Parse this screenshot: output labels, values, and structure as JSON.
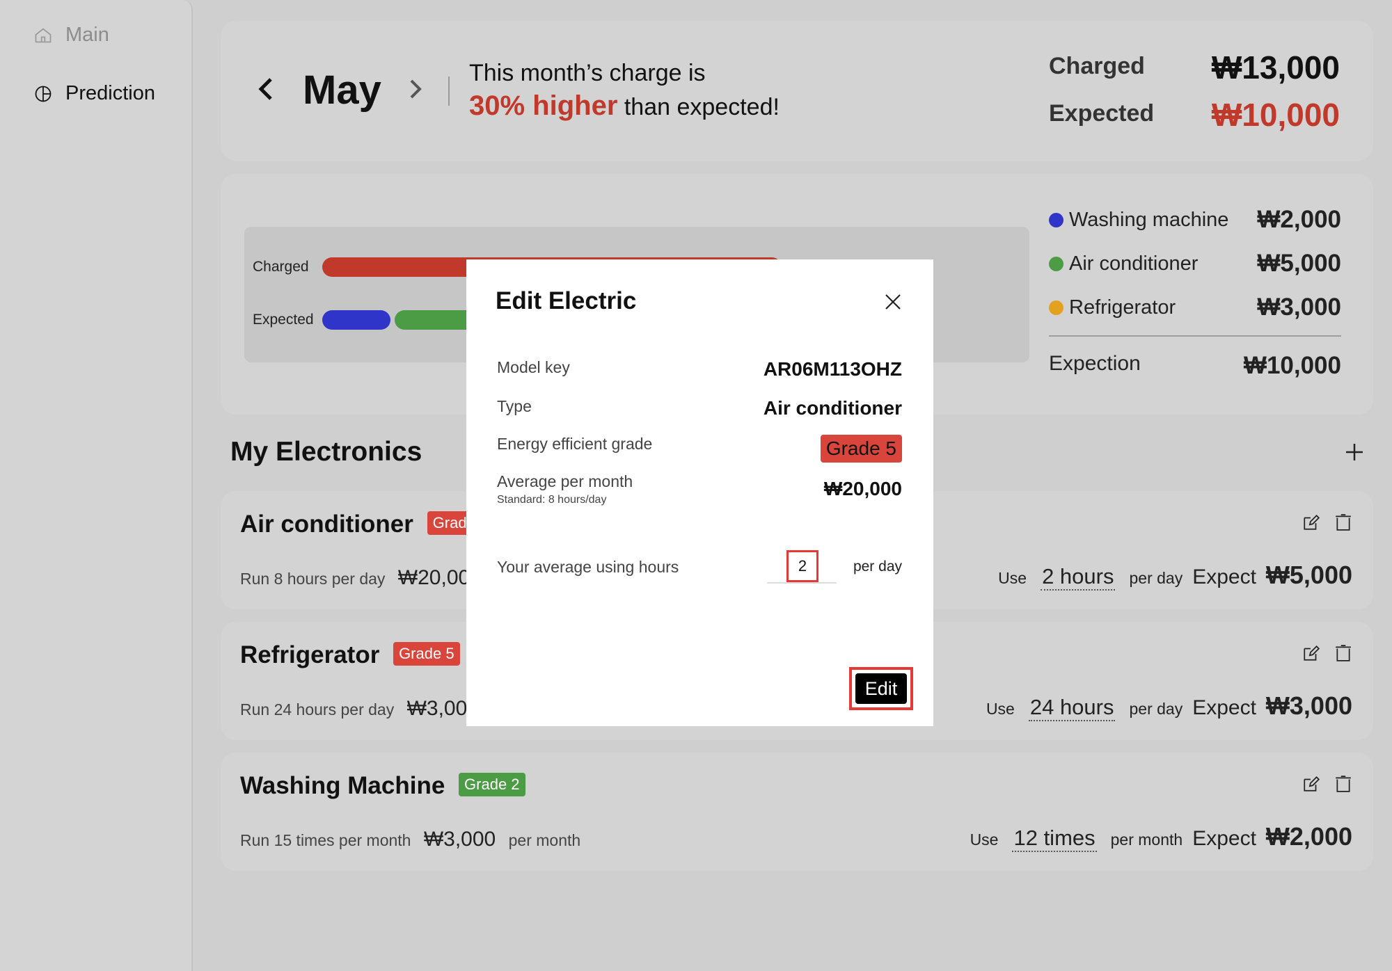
{
  "sidebar": {
    "items": [
      {
        "label": "Main",
        "icon": "home-icon"
      },
      {
        "label": "Prediction",
        "icon": "pie-chart-icon"
      }
    ]
  },
  "header": {
    "month": "May",
    "message_line1": "This month’s charge is",
    "message_highlight": "30% higher",
    "message_rest": "than expected!",
    "charged_label": "Charged",
    "charged_value": "₩13,000",
    "expected_label": "Expected",
    "expected_value": "₩10,000"
  },
  "breakdown": {
    "charged_label": "Charged",
    "expected_label": "Expected",
    "legend": [
      {
        "name": "Washing machine",
        "value": "₩2,000",
        "color": "#2f35c8"
      },
      {
        "name": "Air conditioner",
        "value": "₩5,000",
        "color": "#4c9b45"
      },
      {
        "name": "Refrigerator",
        "value": "₩3,000",
        "color": "#e3a11d"
      }
    ],
    "total_label": "Expection",
    "total_value": "₩10,000"
  },
  "electronics": {
    "title": "My Electronics",
    "items": [
      {
        "name": "Air conditioner",
        "grade": "Grade 5",
        "run": "Run 8 hours per day",
        "run_value": "₩20,000",
        "run_unit": "",
        "use_label": "Use",
        "use_value": "2 hours",
        "use_unit": "per day",
        "expect_label": "Expect",
        "expect_value": "₩5,000"
      },
      {
        "name": "Refrigerator",
        "grade": "Grade 5",
        "run": "Run 24 hours per day",
        "run_value": "₩3,000",
        "run_unit": "",
        "use_label": "Use",
        "use_value": "24 hours",
        "use_unit": "per day",
        "expect_label": "Expect",
        "expect_value": "₩3,000"
      },
      {
        "name": "Washing Machine",
        "grade": "Grade 2",
        "run": "Run 15 times per month",
        "run_value": "₩3,000",
        "run_unit": "per month",
        "use_label": "Use",
        "use_value": "12 times",
        "use_unit": "per month",
        "expect_label": "Expect",
        "expect_value": "₩2,000"
      }
    ]
  },
  "modal": {
    "title": "Edit Electric",
    "model_key_label": "Model key",
    "model_key_value": "AR06M113OHZ",
    "type_label": "Type",
    "type_value": "Air conditioner",
    "grade_label": "Energy efficient grade",
    "grade_value": "Grade 5",
    "avg_label": "Average per month",
    "avg_sub": "Standard: 8 hours/day",
    "avg_value": "₩20,000",
    "hours_label": "Your average using hours",
    "hours_value": "2",
    "hours_unit": "per day",
    "submit_label": "Edit"
  },
  "colors": {
    "accent_red": "#c0392b",
    "grade_red": "#d9453a",
    "grade_green": "#4c9b45"
  }
}
